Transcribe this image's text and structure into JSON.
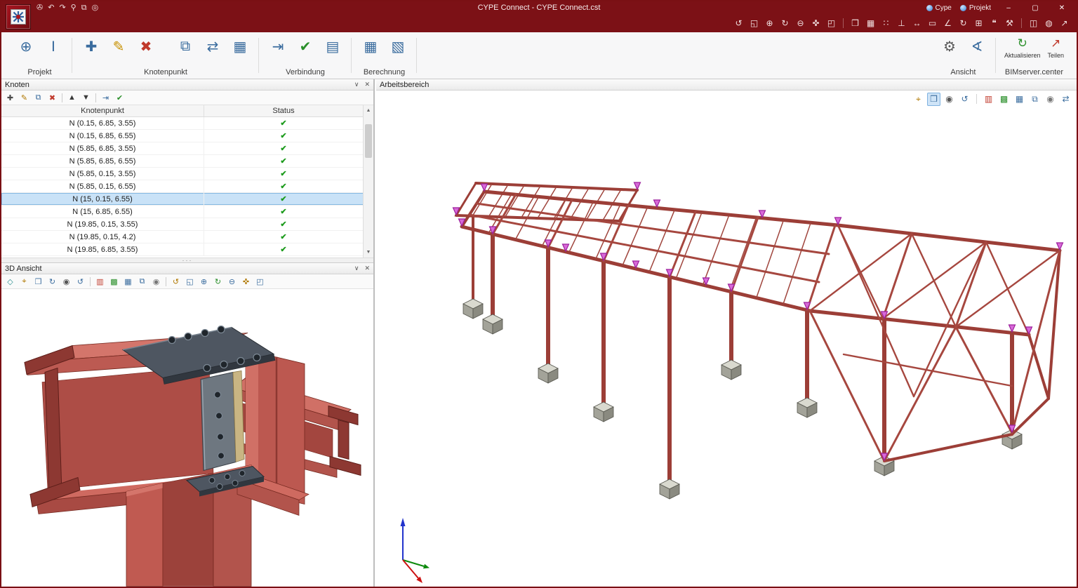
{
  "window": {
    "title": "CYPE Connect - CYPE Connect.cst",
    "account": "Cype",
    "project": "Projekt",
    "controls": {
      "minimize": "–",
      "maximize": "▢",
      "close": "✕"
    }
  },
  "glyphs": {
    "chevron_down": "∨",
    "close": "✕",
    "up": "▲",
    "down": "▼",
    "dots": "···",
    "check": "✔"
  },
  "titlebar": {
    "left_icons": [
      {
        "name": "save-icon",
        "glyph": "✇"
      },
      {
        "name": "undo-icon",
        "glyph": "↶"
      },
      {
        "name": "redo-icon",
        "glyph": "↷"
      },
      {
        "name": "search-icon",
        "glyph": "⚲"
      },
      {
        "name": "layers-icon",
        "glyph": "⧉"
      },
      {
        "name": "capture-icon",
        "glyph": "◎"
      }
    ]
  },
  "view_toolbar": {
    "icons": [
      {
        "name": "orbit-icon",
        "glyph": "↺"
      },
      {
        "name": "zoom-extents-icon",
        "glyph": "◱"
      },
      {
        "name": "zoom-in-icon",
        "glyph": "⊕"
      },
      {
        "name": "refresh-view-icon",
        "glyph": "↻"
      },
      {
        "name": "zoom-out-icon",
        "glyph": "⊖"
      },
      {
        "name": "pan-icon",
        "glyph": "✜"
      },
      {
        "name": "frame-zoom-icon",
        "glyph": "◰"
      },
      {
        "sep": true
      },
      {
        "name": "window-view-icon",
        "glyph": "❒"
      },
      {
        "name": "grid-icon",
        "glyph": "▦"
      },
      {
        "name": "snap-icon",
        "glyph": "∷"
      },
      {
        "name": "ortho-icon",
        "glyph": "⊥"
      },
      {
        "name": "dimension-icon",
        "glyph": "↔"
      },
      {
        "name": "label-icon",
        "glyph": "▭"
      },
      {
        "name": "angle-icon",
        "glyph": "∠"
      },
      {
        "name": "rotate-icon",
        "glyph": "↻"
      },
      {
        "name": "layout-icon",
        "glyph": "⊞"
      },
      {
        "name": "comment-icon",
        "glyph": "❝"
      },
      {
        "name": "tools-icon",
        "glyph": "⚒"
      },
      {
        "sep": true
      },
      {
        "name": "windows-layout-icon",
        "glyph": "◫"
      },
      {
        "name": "web-icon",
        "glyph": "◍"
      },
      {
        "name": "share-icon",
        "glyph": "↗"
      }
    ]
  },
  "ribbon": {
    "groups": [
      {
        "label": "Projekt",
        "icons": [
          {
            "name": "project-globe-icon",
            "glyph": "⊕",
            "color": "#3a6c9e"
          },
          {
            "name": "project-info-icon",
            "glyph": "Ⅰ",
            "color": "#3a6c9e"
          }
        ]
      },
      {
        "label": "Knotenpunkt",
        "icons": [
          {
            "name": "node-new-icon",
            "glyph": "✚",
            "color": "#3a6c9e"
          },
          {
            "name": "node-edit-icon",
            "glyph": "✎",
            "color": "#c79100"
          },
          {
            "name": "node-delete-icon",
            "glyph": "✖",
            "color": "#c0392b"
          },
          {
            "sep": true
          },
          {
            "name": "node-copy-icon",
            "glyph": "⧉",
            "color": "#3a6c9e"
          },
          {
            "name": "node-mirror-icon",
            "glyph": "⇄",
            "color": "#3a6c9e"
          },
          {
            "name": "node-table-icon",
            "glyph": "▦",
            "color": "#3a6c9e"
          }
        ]
      },
      {
        "label": "Verbindung",
        "icons": [
          {
            "name": "connection-import-icon",
            "glyph": "⇥",
            "color": "#3a6c9e"
          },
          {
            "name": "connection-check-icon",
            "glyph": "✔",
            "color": "#2a8f2a"
          },
          {
            "name": "connection-report-icon",
            "glyph": "▤",
            "color": "#3a6c9e"
          }
        ]
      },
      {
        "label": "Berechnung",
        "icons": [
          {
            "name": "calculate-icon",
            "glyph": "▦",
            "color": "#3a6c9e"
          },
          {
            "name": "calculate-detail-icon",
            "glyph": "▧",
            "color": "#3a6c9e"
          }
        ]
      }
    ],
    "right_groups": [
      {
        "label": "Ansicht",
        "icons": [
          {
            "name": "options-gear-icon",
            "glyph": "⚙",
            "color": "#5a5a5a"
          },
          {
            "name": "measure-icon",
            "glyph": "∢",
            "color": "#3a6c9e"
          }
        ]
      }
    ],
    "bim": {
      "label": "BIMserver.center",
      "items": [
        {
          "label": "Aktualisieren",
          "glyph": "↻",
          "name": "refresh-icon"
        },
        {
          "label": "Teilen",
          "glyph": "↗",
          "name": "share-icon"
        }
      ]
    }
  },
  "knoten_panel": {
    "title": "Knoten",
    "toolbar": [
      {
        "name": "add-node-icon",
        "glyph": "✚",
        "color": "#4a4a4a"
      },
      {
        "name": "edit-node-icon",
        "glyph": "✎",
        "color": "#b07800"
      },
      {
        "name": "copy-node-icon",
        "glyph": "⧉",
        "color": "#3a6c9e"
      },
      {
        "name": "delete-node-icon",
        "glyph": "✖",
        "color": "#c0392b"
      },
      {
        "sep": true
      },
      {
        "name": "move-up-icon",
        "glyph": "▲",
        "color": "#3a3a3a"
      },
      {
        "name": "move-down-icon",
        "glyph": "▼",
        "color": "#3a3a3a"
      },
      {
        "sep": true
      },
      {
        "name": "import-nodes-icon",
        "glyph": "⇥",
        "color": "#3a6c9e"
      },
      {
        "name": "check-nodes-icon",
        "glyph": "✔",
        "color": "#2a8f2a"
      }
    ],
    "columns": [
      "Knotenpunkt",
      "Status"
    ],
    "status_glyph": "✔",
    "selected_index": 6,
    "rows": [
      {
        "name": "N (0.15, 6.85, 3.55)",
        "status": "ok"
      },
      {
        "name": "N (0.15, 6.85, 6.55)",
        "status": "ok"
      },
      {
        "name": "N (5.85, 6.85, 3.55)",
        "status": "ok"
      },
      {
        "name": "N (5.85, 6.85, 6.55)",
        "status": "ok"
      },
      {
        "name": "N (5.85, 0.15, 3.55)",
        "status": "ok"
      },
      {
        "name": "N (5.85, 0.15, 6.55)",
        "status": "ok"
      },
      {
        "name": "N (15, 0.15, 6.55)",
        "status": "ok"
      },
      {
        "name": "N (15, 6.85, 6.55)",
        "status": "ok"
      },
      {
        "name": "N (19.85, 0.15, 3.55)",
        "status": "ok"
      },
      {
        "name": "N (19.85, 0.15, 4.2)",
        "status": "ok"
      },
      {
        "name": "N (19.85, 6.85, 3.55)",
        "status": "ok"
      }
    ]
  },
  "ansicht3d_panel": {
    "title": "3D Ansicht",
    "toolbar": [
      {
        "name": "isometric-icon",
        "glyph": "◇",
        "color": "#2a8f8f"
      },
      {
        "name": "axes-icon",
        "glyph": "⌖",
        "color": "#b07800"
      },
      {
        "name": "box-view-icon",
        "glyph": "❒",
        "color": "#3a6c9e"
      },
      {
        "name": "rotate-icon",
        "glyph": "↻",
        "color": "#3a6c9e"
      },
      {
        "name": "eye-icon",
        "glyph": "◉",
        "color": "#555555"
      },
      {
        "name": "orbit-icon",
        "glyph": "↺",
        "color": "#3a6c9e"
      },
      {
        "sep": true
      },
      {
        "name": "errors-report-icon",
        "glyph": "▥",
        "color": "#c0392b"
      },
      {
        "name": "results-ok-icon",
        "glyph": "▩",
        "color": "#2a8f2a"
      },
      {
        "name": "table-icon",
        "glyph": "▦",
        "color": "#3a6c9e"
      },
      {
        "name": "layers-icon",
        "glyph": "⧉",
        "color": "#3a6c9e"
      },
      {
        "name": "visibility-icon",
        "glyph": "◉",
        "color": "#777777"
      },
      {
        "sep": true
      },
      {
        "name": "zoom-orbit-icon",
        "glyph": "↺",
        "color": "#b07800"
      },
      {
        "name": "zoom-extents-icon",
        "glyph": "◱",
        "color": "#3a6c9e"
      },
      {
        "name": "zoom-in-icon",
        "glyph": "⊕",
        "color": "#3a6c9e"
      },
      {
        "name": "refresh-icon",
        "glyph": "↻",
        "color": "#2a8f2a"
      },
      {
        "name": "zoom-out-icon",
        "glyph": "⊖",
        "color": "#3a6c9e"
      },
      {
        "name": "pan-icon",
        "glyph": "✜",
        "color": "#b07800"
      },
      {
        "name": "frame-zoom-icon",
        "glyph": "◰",
        "color": "#3a6c9e"
      }
    ]
  },
  "workspace": {
    "title": "Arbeitsbereich",
    "toolbar": [
      {
        "name": "axes-icon",
        "glyph": "⌖",
        "color": "#b07800"
      },
      {
        "name": "select-box-icon",
        "glyph": "❒",
        "color": "#3a6c9e",
        "active": true
      },
      {
        "name": "eye-icon",
        "glyph": "◉",
        "color": "#555555"
      },
      {
        "name": "orbit-icon",
        "glyph": "↺",
        "color": "#3a6c9e"
      },
      {
        "sep": true
      },
      {
        "name": "errors-report-icon",
        "glyph": "▥",
        "color": "#c0392b"
      },
      {
        "name": "results-ok-icon",
        "glyph": "▩",
        "color": "#2a8f2a"
      },
      {
        "name": "table-icon",
        "glyph": "▦",
        "color": "#3a6c9e"
      },
      {
        "name": "layers-icon",
        "glyph": "⧉",
        "color": "#3a6c9e"
      },
      {
        "name": "visibility-icon",
        "glyph": "◉",
        "color": "#777777"
      },
      {
        "name": "bim-sync-icon",
        "glyph": "⇄",
        "color": "#3a6c9e"
      }
    ]
  }
}
